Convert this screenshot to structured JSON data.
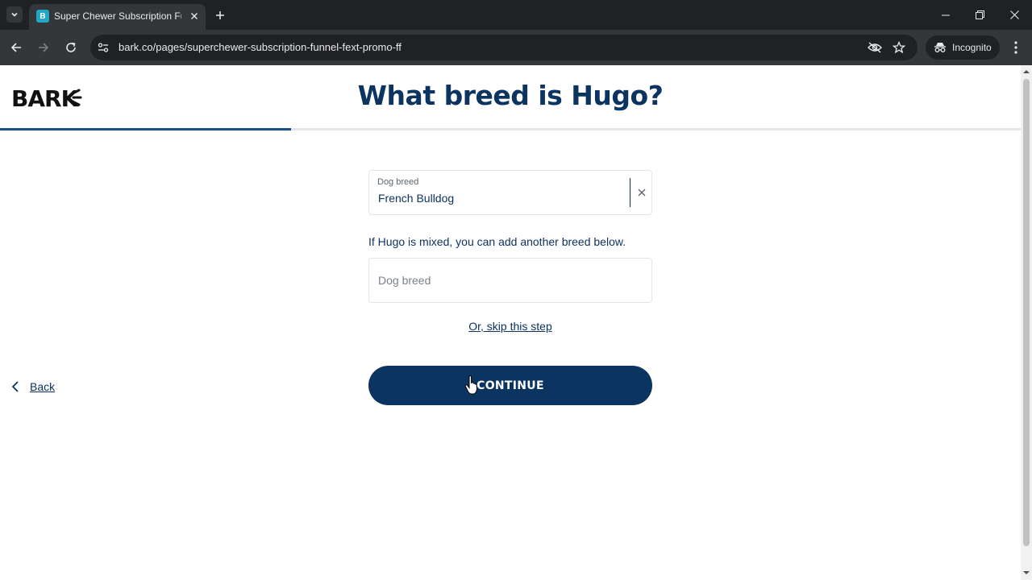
{
  "browser": {
    "tab_title": "Super Chewer Subscription Fun",
    "url": "bark.co/pages/superchewer-subscription-funnel-fext-promo-ff",
    "incognito_label": "Incognito",
    "favicon_letter": "B"
  },
  "page": {
    "logo_text": "BARK",
    "heading": "What breed is Hugo?",
    "progress_fraction": 0.285,
    "breed_field": {
      "label": "Dog breed",
      "value": "French Bulldog"
    },
    "hint": "If Hugo is mixed, you can add another breed below.",
    "second_breed_field": {
      "placeholder": "Dog breed"
    },
    "skip_link": "Or, skip this step",
    "continue_label": "CONTINUE",
    "back_label": "Back"
  },
  "colors": {
    "brand_navy": "#0c3460",
    "progress": "#1d4f8a",
    "chrome_dark": "#202124",
    "chrome_mid": "#35363a"
  }
}
